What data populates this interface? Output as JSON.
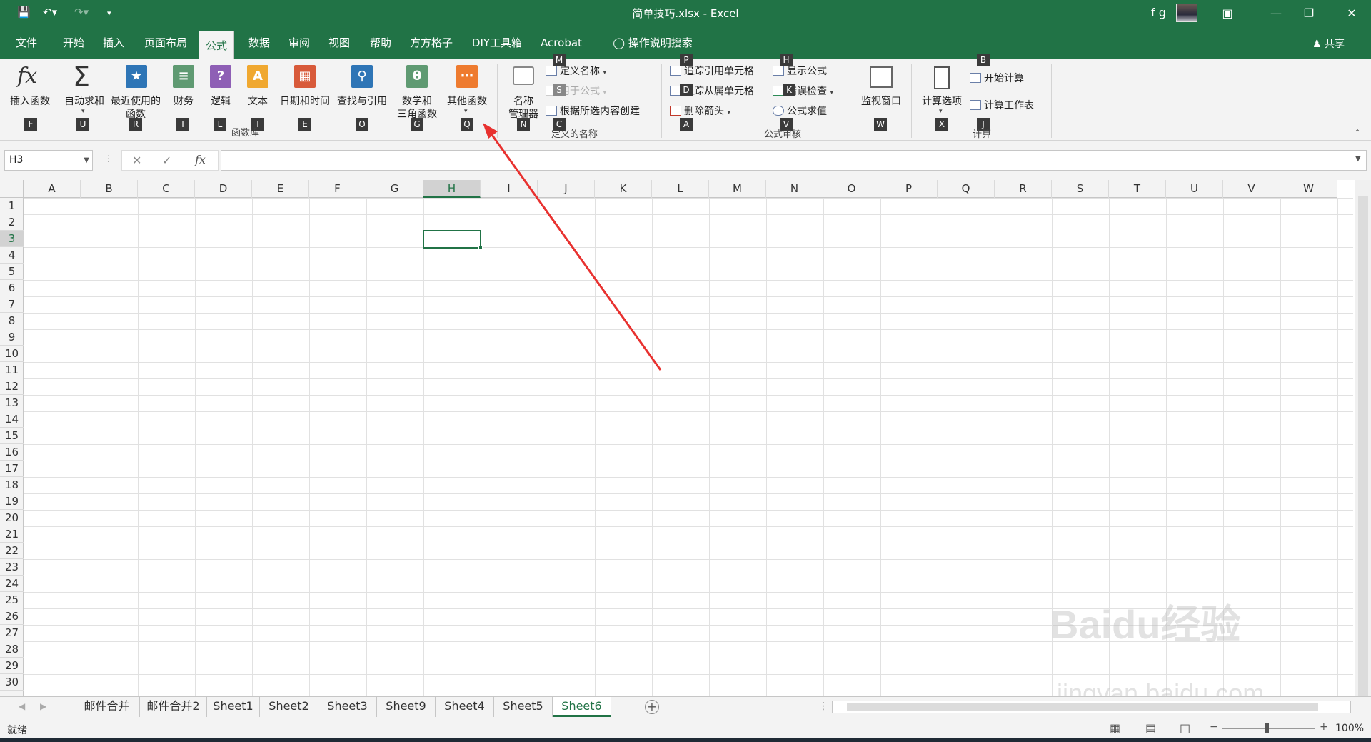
{
  "window": {
    "title": "简单技巧.xlsx  -  Excel",
    "user": "f g"
  },
  "tabs": [
    "文件",
    "开始",
    "插入",
    "页面布局",
    "公式",
    "数据",
    "审阅",
    "视图",
    "帮助",
    "方方格子",
    "DIY工具箱",
    "Acrobat"
  ],
  "active_tab": "公式",
  "tell_me": "操作说明搜索",
  "share": "共享",
  "ribbon": {
    "function_library": {
      "buttons": [
        {
          "label": "插入函数",
          "key": "F"
        },
        {
          "label": "自动求和",
          "key": "U"
        },
        {
          "label": "最近使用的",
          "label2": "函数",
          "key": "R"
        },
        {
          "label": "财务",
          "key": "I"
        },
        {
          "label": "逻辑",
          "key": "L"
        },
        {
          "label": "文本",
          "key": "T"
        },
        {
          "label": "日期和时间",
          "key": "E"
        },
        {
          "label": "查找与引用",
          "key": "O"
        },
        {
          "label": "数学和",
          "label2": "三角函数",
          "key": "G"
        },
        {
          "label": "其他函数",
          "key": "Q"
        }
      ],
      "group_label": "函数库"
    },
    "defined_names": {
      "name_manager": "名称",
      "name_manager2": "管理器",
      "name_manager_key": "N",
      "define_name": "定义名称",
      "define_name_key": "M",
      "use_in_formula": "用于公式",
      "use_in_formula_key": "S",
      "create_from_selection": "根据所选内容创建",
      "create_key": "C",
      "group_label": "定义的名称"
    },
    "formula_auditing": {
      "trace_precedents": "追踪引用单元格",
      "trace_precedents_key": "P",
      "trace_dependents": "追踪从属单元格",
      "trace_dependents_key": "D",
      "remove_arrows": "删除箭头",
      "remove_arrows_key": "A",
      "show_formulas": "显示公式",
      "show_formulas_key": "H",
      "error_checking": "错误检查",
      "error_checking_key": "K",
      "evaluate_formula": "公式求值",
      "evaluate_formula_key": "V",
      "watch_window": "监视窗口",
      "watch_window_key": "W",
      "group_label": "公式审核"
    },
    "calculation": {
      "calc_options": "计算选项",
      "calc_options_key": "X",
      "calc_now": "开始计算",
      "calc_now_key": "B",
      "calc_sheet": "计算工作表",
      "calc_sheet_key": "J",
      "group_label": "计算"
    }
  },
  "formula_bar": {
    "name_box": "H3",
    "value": ""
  },
  "columns": [
    "A",
    "B",
    "C",
    "D",
    "E",
    "F",
    "G",
    "H",
    "I",
    "J",
    "K",
    "L",
    "M",
    "N",
    "O",
    "P",
    "Q",
    "R",
    "S",
    "T",
    "U",
    "V",
    "W"
  ],
  "selected_column": "H",
  "rows": [
    "1",
    "2",
    "3",
    "4",
    "5",
    "6",
    "7",
    "8",
    "9",
    "10",
    "11",
    "12",
    "13",
    "14",
    "15",
    "16",
    "17",
    "18",
    "19",
    "20",
    "21",
    "22",
    "23",
    "24",
    "25",
    "26",
    "27",
    "28",
    "29",
    "30"
  ],
  "selected_row": "3",
  "sheets": [
    "邮件合并",
    "邮件合并2",
    "Sheet1",
    "Sheet2",
    "Sheet3",
    "Sheet9",
    "Sheet4",
    "Sheet5",
    "Sheet6"
  ],
  "active_sheet": "Sheet6",
  "status": {
    "ready": "就绪",
    "zoom": "100%"
  },
  "watermark": {
    "main": "Baidu经验",
    "sub": "jingyan.baidu.com"
  },
  "colors": {
    "excel_green": "#217346",
    "arrow_red": "#e8312f"
  }
}
